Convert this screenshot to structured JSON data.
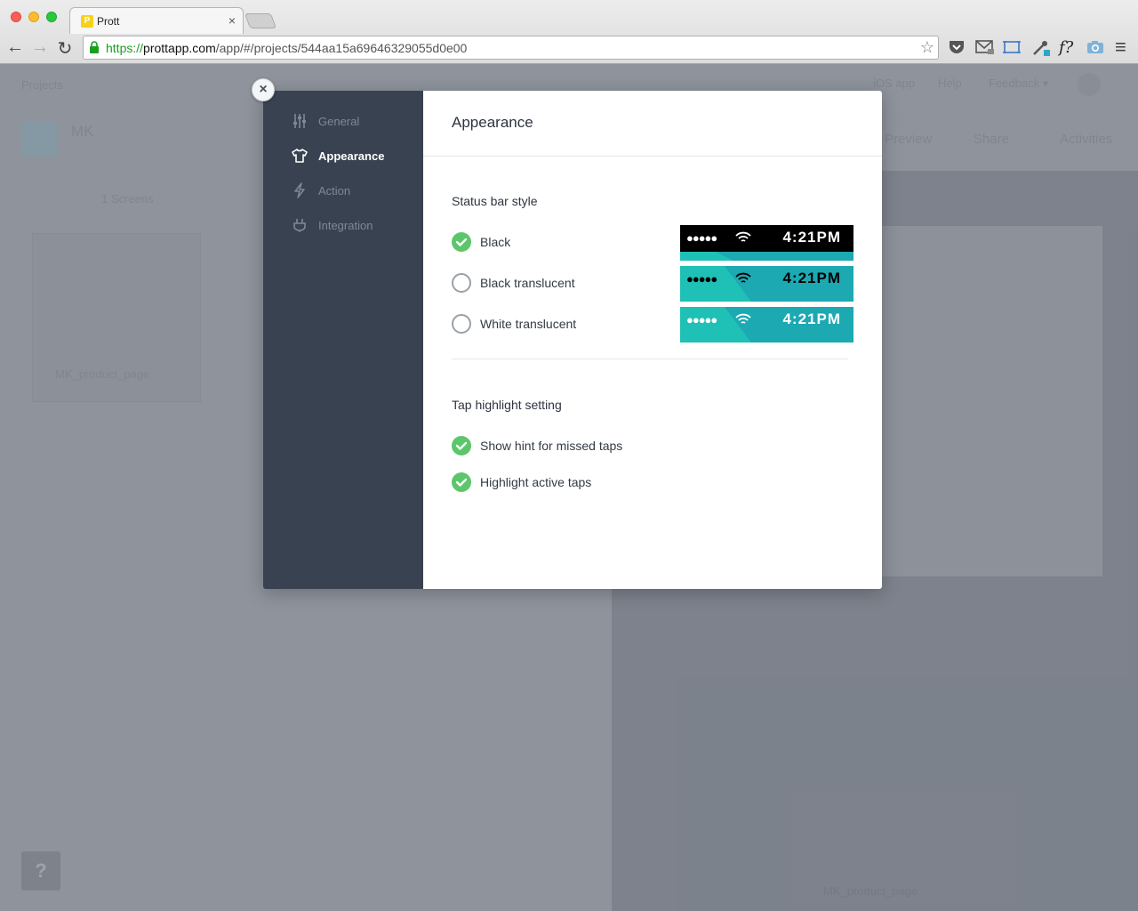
{
  "browser": {
    "tab_title": "Prott",
    "tab_favicon_letter": "P",
    "tab_close": "×",
    "url_scheme": "https://",
    "url_host": "prottapp.com",
    "url_path": "/app/#/projects/544aa15a69646329055d0e00",
    "back_glyph": "←",
    "forward_glyph": "→",
    "reload_glyph": "↻",
    "star_glyph": "☆",
    "ext_f": "f?",
    "menu_glyph": "≡"
  },
  "app_background": {
    "breadcrumb": "Projects",
    "topnav": [
      "iOS app",
      "Help",
      "Feedback ▾"
    ],
    "project_name": "MK",
    "toolbar": [
      "Preview",
      "Share",
      "Activities"
    ],
    "screens_count": "1 Screens",
    "card_name": "MK_product_page",
    "footer_screen_name": "MK_product_page",
    "help_glyph": "?"
  },
  "modal": {
    "close_glyph": "×",
    "sidebar": [
      {
        "label": "General",
        "icon": "sliders-icon",
        "active": false
      },
      {
        "label": "Appearance",
        "icon": "tshirt-icon",
        "active": true
      },
      {
        "label": "Action",
        "icon": "bolt-icon",
        "active": false
      },
      {
        "label": "Integration",
        "icon": "plug-icon",
        "active": false
      }
    ],
    "title": "Appearance",
    "status_bar": {
      "heading": "Status bar style",
      "options": [
        {
          "label": "Black",
          "selected": true,
          "preview_dots": "●●●●●",
          "preview_time": "4:21PM"
        },
        {
          "label": "Black translucent",
          "selected": false,
          "preview_dots": "●●●●●",
          "preview_time": "4:21PM"
        },
        {
          "label": "White translucent",
          "selected": false,
          "preview_dots": "●●●●●",
          "preview_time": "4:21PM"
        }
      ]
    },
    "tap_highlight": {
      "heading": "Tap highlight setting",
      "options": [
        {
          "label": "Show hint for missed taps",
          "checked": true
        },
        {
          "label": "Highlight active taps",
          "checked": true
        }
      ]
    }
  },
  "colors": {
    "accent_green": "#5cc66a",
    "sidebar_bg": "#394250",
    "teal": "#1fb0b8"
  }
}
